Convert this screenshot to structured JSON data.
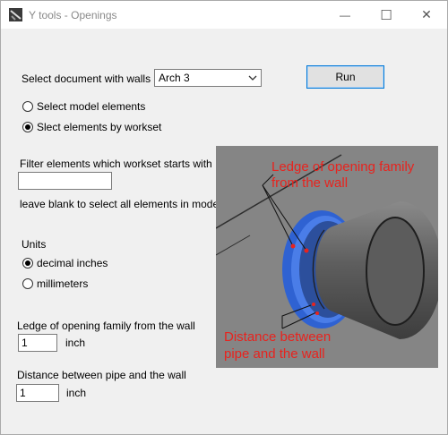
{
  "window": {
    "title": "Y tools - Openings",
    "controls": {
      "minimize": "—",
      "maximize": "☐",
      "close": "✕"
    }
  },
  "form": {
    "document_label": "Select document with walls",
    "document_value": "Arch 3",
    "run_label": "Run",
    "selection_mode": {
      "options": [
        "Select model elements",
        "Slect elements by workset"
      ],
      "selected_index": 1
    },
    "filter_label": "Filter elements which workset starts with",
    "filter_value": "",
    "filter_hint": "leave blank to select all elements in model",
    "units_label": "Units",
    "units": {
      "options": [
        "decimal inches",
        "millimeters"
      ],
      "selected_index": 0
    },
    "ledge_label": "Ledge of opening family from the wall",
    "ledge_value": "1",
    "ledge_unit": "inch",
    "distance_label": "Distance between pipe and the wall",
    "distance_value": "1",
    "distance_unit": "inch"
  },
  "illustration": {
    "annotation_top": [
      "Ledge of opening family",
      "from the wall"
    ],
    "annotation_bottom": [
      "Distance between",
      "pipe and the wall"
    ],
    "colors": {
      "background": "#8c8c8c",
      "annotation": "#e8231e",
      "ring": "#2f62d2",
      "pipe": "#6a6a6a",
      "pipe_face": "#5a5a5a"
    }
  }
}
